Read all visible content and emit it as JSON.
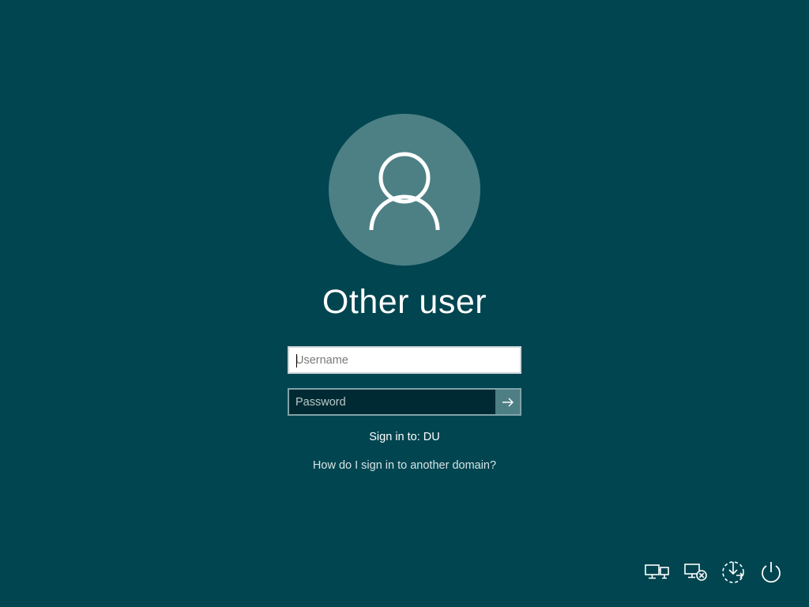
{
  "user": {
    "name": "Other user"
  },
  "form": {
    "username_placeholder": "Username",
    "password_placeholder": "Password",
    "username_value": "",
    "password_value": ""
  },
  "sign_in": {
    "target_text": "Sign in to: DU",
    "domain_help_link": "How do I sign in to another domain?"
  },
  "icons": {
    "avatar": "user-icon",
    "submit": "arrow-right-icon",
    "network": "network-icon",
    "disconnect": "network-disconnect-icon",
    "ease_of_access": "ease-of-access-icon",
    "power": "power-icon"
  },
  "colors": {
    "background": "#004550",
    "avatar_circle": "#4d8085",
    "submit_button": "#4d7f85",
    "password_field": "#002a33"
  }
}
